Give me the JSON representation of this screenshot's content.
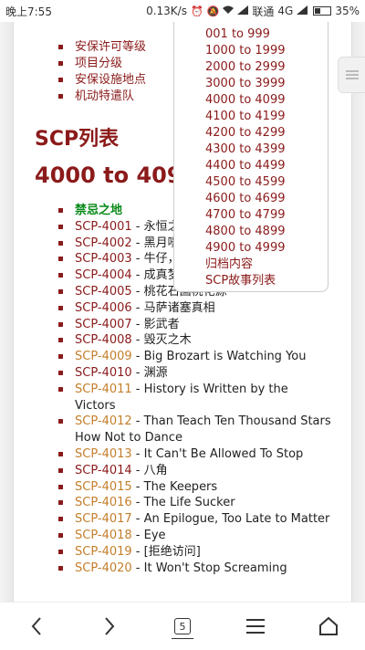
{
  "status_bar": {
    "time": "晚上7:55",
    "speed": "0.13K/s",
    "carrier": "联通",
    "network": "4G",
    "battery": "35%"
  },
  "top_links": [
    "安保许可等级",
    "项目分级",
    "安保设施地点",
    "机动特遣队"
  ],
  "heading": "SCP列表",
  "range_heading": "4000 to 4099",
  "range_box": [
    "001 to 999",
    "1000 to 1999",
    "2000 to 2999",
    "3000 to 3999",
    "4000 to 4099",
    "4100 to 4199",
    "4200 to 4299",
    "4300 to 4399",
    "4400 to 4499",
    "4500 to 4599",
    "4600 to 4699",
    "4700 to 4799",
    "4800 to 4899",
    "4900 to 4999",
    "归档内容",
    "SCP故事列表"
  ],
  "scp_entries": [
    {
      "id": "禁忌之地",
      "title": "",
      "style": "forbidden"
    },
    {
      "id": "SCP-4001",
      "title": " - 永恒之亚历山大城",
      "style": "red"
    },
    {
      "id": "SCP-4002",
      "title": " - 黑月嚎叫于时界之外",
      "style": "red"
    },
    {
      "id": "SCP-4003",
      "title": " - 牛仔，天主教，白垩纪",
      "style": "red"
    },
    {
      "id": "SCP-4004",
      "title": " - 成真梦想",
      "style": "red"
    },
    {
      "id": "SCP-4005",
      "title": " - 桃花石国桃花源",
      "style": "red"
    },
    {
      "id": "SCP-4006",
      "title": " - 马萨诸塞真相",
      "style": "red"
    },
    {
      "id": "SCP-4007",
      "title": " - 影武者",
      "style": "red"
    },
    {
      "id": "SCP-4008",
      "title": " - 毁灭之木",
      "style": "red"
    },
    {
      "id": "SCP-4009",
      "title": " - Big Brozart is Watching You",
      "style": "orange"
    },
    {
      "id": "SCP-4010",
      "title": " - 渊源",
      "style": "red"
    },
    {
      "id": "SCP-4011",
      "title": " - History is Written by the Victors",
      "style": "orange"
    },
    {
      "id": "SCP-4012",
      "title": " - Than Teach Ten Thousand Stars How Not to Dance",
      "style": "orange"
    },
    {
      "id": "SCP-4013",
      "title": " - It Can't Be Allowed To Stop",
      "style": "orange"
    },
    {
      "id": "SCP-4014",
      "title": " - 八角",
      "style": "red"
    },
    {
      "id": "SCP-4015",
      "title": " - The Keepers",
      "style": "orange"
    },
    {
      "id": "SCP-4016",
      "title": " - The Life Sucker",
      "style": "orange"
    },
    {
      "id": "SCP-4017",
      "title": " - An Epilogue, Too Late to Matter",
      "style": "orange"
    },
    {
      "id": "SCP-4018",
      "title": " - Eye",
      "style": "orange"
    },
    {
      "id": "SCP-4019",
      "title": " - [拒绝访问]",
      "style": "orange"
    },
    {
      "id": "SCP-4020",
      "title": " - It Won't Stop Screaming",
      "style": "orange"
    }
  ],
  "bottom_nav": {
    "back_icon": "chevron-left-icon",
    "forward_icon": "chevron-right-icon",
    "tab_count": "5",
    "menu_icon": "hamburger-icon",
    "home_icon": "home-icon"
  },
  "colors": {
    "link_red": "#8b1a1a",
    "link_orange": "#c47e2a",
    "forbidden_green": "#0a8a1a"
  }
}
